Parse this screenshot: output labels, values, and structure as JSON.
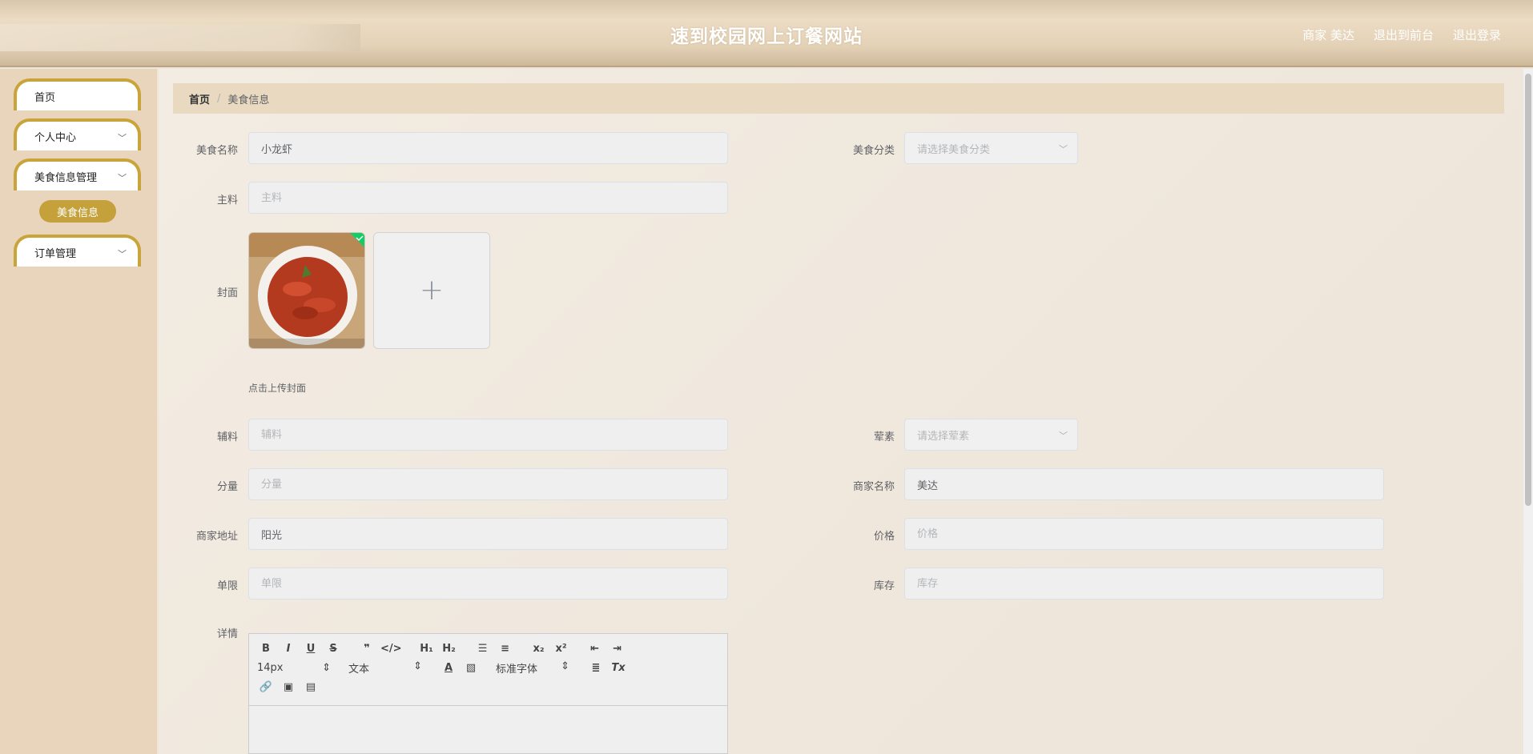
{
  "header": {
    "title": "速到校园网上订餐网站",
    "user": "商家 美达",
    "back_to_front": "退出到前台",
    "logout": "退出登录"
  },
  "sidebar": {
    "items": [
      {
        "label": "首页"
      },
      {
        "label": "个人中心"
      },
      {
        "label": "美食信息管理"
      },
      {
        "label": "订单管理"
      }
    ],
    "active_sub": "美食信息"
  },
  "breadcrumb": {
    "home": "首页",
    "current": "美食信息"
  },
  "form": {
    "name_label": "美食名称",
    "name_value": "小龙虾",
    "category_label": "美食分类",
    "category_placeholder": "请选择美食分类",
    "main_label": "主料",
    "main_placeholder": "主料",
    "cover_label": "封面",
    "cover_hint": "点击上传封面",
    "sub_label": "辅料",
    "sub_placeholder": "辅料",
    "meat_label": "荤素",
    "meat_placeholder": "请选择荤素",
    "portion_label": "分量",
    "portion_placeholder": "分量",
    "merchant_label": "商家名称",
    "merchant_value": "美达",
    "address_label": "商家地址",
    "address_value": "阳光",
    "price_label": "价格",
    "price_placeholder": "价格",
    "limit_label": "单限",
    "limit_placeholder": "单限",
    "stock_label": "库存",
    "stock_placeholder": "库存",
    "detail_label": "详情"
  },
  "editor": {
    "font_size": "14px",
    "text_type": "文本",
    "font_family": "标准字体"
  },
  "colors": {
    "accent": "#c4a13a",
    "header_bg": "#e4d2b7",
    "sidebar_bg": "#e8d5bc"
  }
}
